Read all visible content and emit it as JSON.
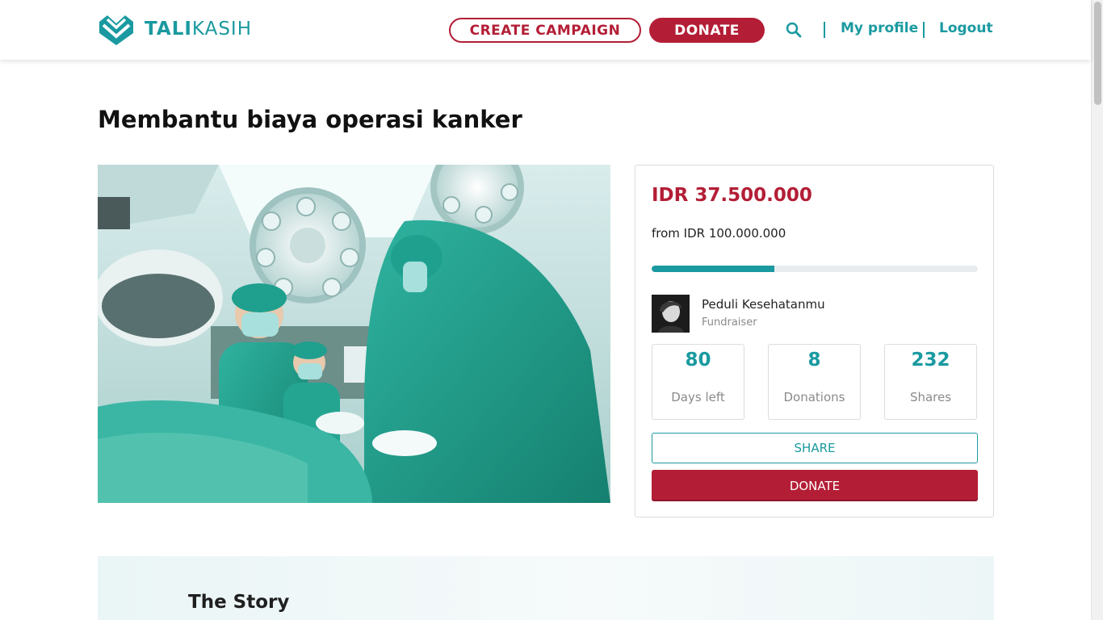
{
  "brand": {
    "name_bold": "TALI",
    "name_light": "KASIH",
    "color": "#1a9aa0",
    "accent": "#b31e36"
  },
  "nav": {
    "create_campaign": "CREATE CAMPAIGN",
    "donate": "DONATE",
    "search_icon": "search-icon",
    "my_profile": "My profile",
    "logout": "Logout"
  },
  "campaign": {
    "title": "Membantu biaya operasi kanker",
    "image": "surgery-photo",
    "raised": "IDR  37.500.000",
    "goal": "from IDR 100.000.000",
    "progress_fraction": 0.375,
    "fundraiser": {
      "name": "Peduli Kesehatanmu",
      "role": "Fundraiser"
    },
    "stats": [
      {
        "value": "80",
        "label": "Days left"
      },
      {
        "value": "8",
        "label": "Donations"
      },
      {
        "value": "232",
        "label": "Shares"
      }
    ],
    "share_button": "SHARE",
    "donate_button": "DONATE"
  },
  "story": {
    "title": "The Story"
  }
}
